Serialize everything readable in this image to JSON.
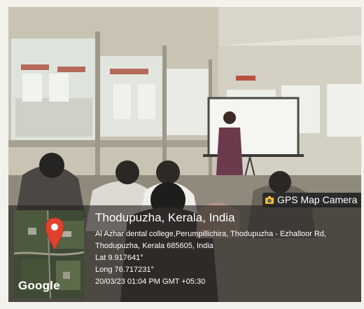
{
  "watermark": {
    "app_label": "GPS Map Camera",
    "location_title": "Thodupuzha, Kerala, India",
    "address_line1": "Al Azhar dental college,Perumpillichira, Thodupuzha - Ezhalloor Rd,",
    "address_line2": "Thodupuzha, Kerala 685605, India",
    "lat": "Lat 9.917641°",
    "long": "Long 76.717231°",
    "datetime": "20/03/23 01:04 PM GMT +05:30",
    "map_brand": "Google"
  },
  "colors": {
    "badge_bg": "#2b2b2b",
    "pin_red": "#e0422f",
    "overlay_bg": "rgba(35,33,30,0.62)"
  },
  "icons": [
    "camera-icon",
    "map-pin-icon"
  ]
}
